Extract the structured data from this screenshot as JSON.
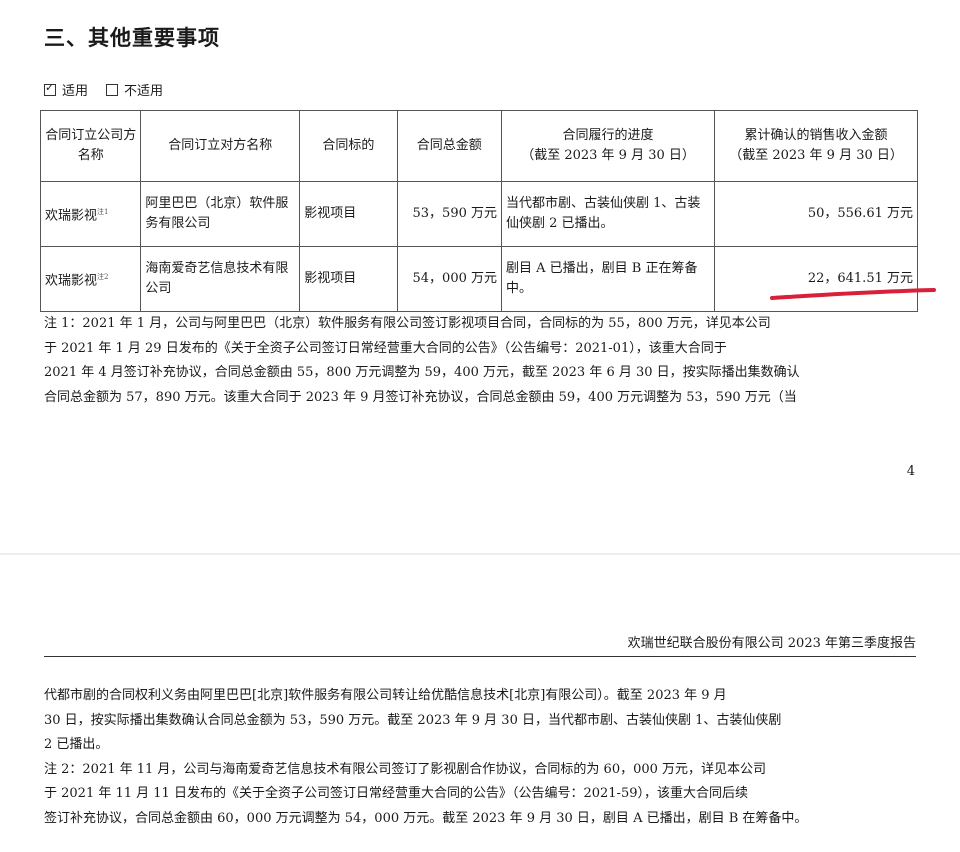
{
  "section_title": "三、其他重要事项",
  "applicability": {
    "applicable_label": "适用",
    "applicable_checked": true,
    "not_applicable_label": "不适用",
    "not_applicable_checked": false
  },
  "table": {
    "headers": {
      "company": "合同订立公司方名称",
      "counterparty": "合同订立对方名称",
      "subject": "合同标的",
      "total_amount": "合同总金额",
      "progress_title": "合同履行的进度",
      "progress_sub": "（截至 2023 年 9 月 30 日）",
      "revenue_title": "累计确认的销售收入金额",
      "revenue_sub": "（截至 2023 年 9 月 30 日）"
    },
    "rows": [
      {
        "company": "欢瑞影视",
        "note": "注1",
        "counterparty": "阿里巴巴（北京）软件服务有限公司",
        "subject": "影视项目",
        "total_amount": "53，590 万元",
        "progress": "当代都市剧、古装仙侠剧 1、古装仙侠剧 2 已播出。",
        "revenue": "50，556.61 万元"
      },
      {
        "company": "欢瑞影视",
        "note": "注2",
        "counterparty": "海南爱奇艺信息技术有限公司",
        "subject": "影视项目",
        "total_amount": "54，000 万元",
        "progress": "剧目 A 已播出，剧目 B 正在筹备中。",
        "revenue": "22，641.51 万元"
      }
    ]
  },
  "highlight_color": "#d8203a",
  "note1": [
    "注 1：2021 年 1 月，公司与阿里巴巴（北京）软件服务有限公司签订影视项目合同，合同标的为 55，800 万元，详见本公司",
    "于 2021 年 1 月 29 日发布的《关于全资子公司签订日常经营重大合同的公告》（公告编号：2021-01），该重大合同于",
    "2021 年 4 月签订补充协议，合同总金额由 55，800 万元调整为 59，400 万元，截至 2023 年 6 月 30 日，按实际播出集数确认",
    "合同总金额为 57，890 万元。该重大合同于 2023 年 9 月签订补充协议，合同总金额由 59，400 万元调整为 53，590 万元（当"
  ],
  "page_number": "4",
  "report_header": "欢瑞世纪联合股份有限公司 2023 年第三季度报告",
  "note_continuation": [
    "代都市剧的合同权利义务由阿里巴巴[北京]软件服务有限公司转让给优酷信息技术[北京]有限公司）。截至 2023 年 9 月",
    "30 日，按实际播出集数确认合同总金额为 53，590 万元。截至 2023 年 9 月 30 日，当代都市剧、古装仙侠剧 1、古装仙侠剧",
    "2 已播出。",
    "注 2：2021 年 11 月，公司与海南爱奇艺信息技术有限公司签订了影视剧合作协议，合同标的为 60，000 万元，详见本公司",
    "于 2021 年 11 月 11 日发布的《关于全资子公司签订日常经营重大合同的公告》（公告编号：2021-59），该重大合同后续",
    "签订补充协议，合同总金额由 60，000 万元调整为 54，000 万元。截至 2023 年 9 月 30 日，剧目 A 已播出，剧目 B 在筹备中。"
  ]
}
